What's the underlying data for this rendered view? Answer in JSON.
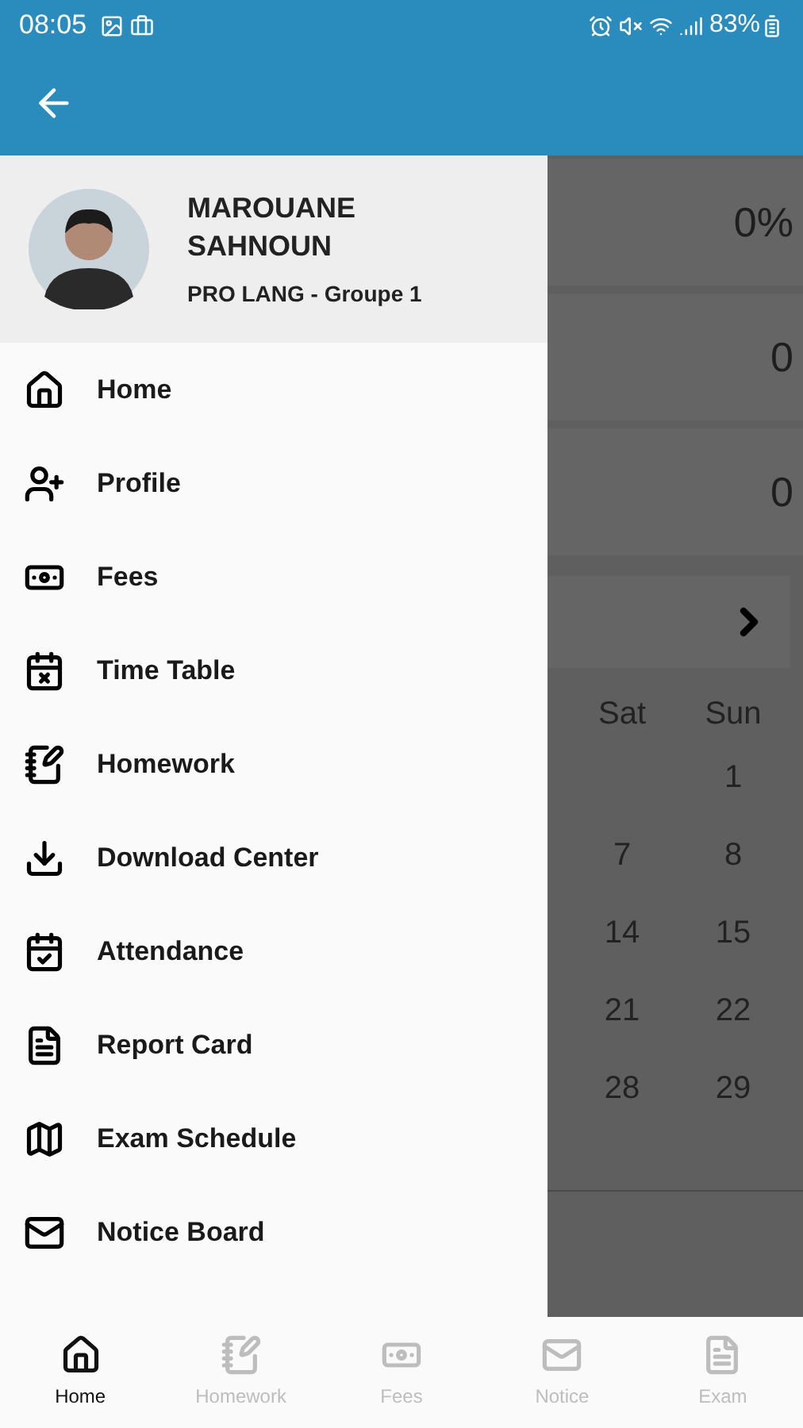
{
  "status_bar": {
    "time": "08:05",
    "battery": "83%"
  },
  "drawer": {
    "user": {
      "name": "MAROUANE SAHNOUN",
      "group": "PRO LANG - Groupe 1"
    },
    "items": [
      {
        "label": "Home"
      },
      {
        "label": "Profile"
      },
      {
        "label": "Fees"
      },
      {
        "label": "Time Table"
      },
      {
        "label": "Homework"
      },
      {
        "label": "Download Center"
      },
      {
        "label": "Attendance"
      },
      {
        "label": "Report Card"
      },
      {
        "label": "Exam Schedule"
      },
      {
        "label": "Notice Board"
      }
    ]
  },
  "background": {
    "stats": [
      "0%",
      "0",
      "0"
    ],
    "calendar": {
      "weekdays": [
        "Sat",
        "Sun"
      ],
      "rows": [
        [
          "",
          "1"
        ],
        [
          "7",
          "8"
        ],
        [
          "14",
          "15"
        ],
        [
          "21",
          "22"
        ],
        [
          "28",
          "29"
        ]
      ]
    }
  },
  "bottom_nav": [
    {
      "label": "Home",
      "selected": true
    },
    {
      "label": "Homework",
      "selected": false
    },
    {
      "label": "Fees",
      "selected": false
    },
    {
      "label": "Notice",
      "selected": false
    },
    {
      "label": "Exam",
      "selected": false
    }
  ]
}
